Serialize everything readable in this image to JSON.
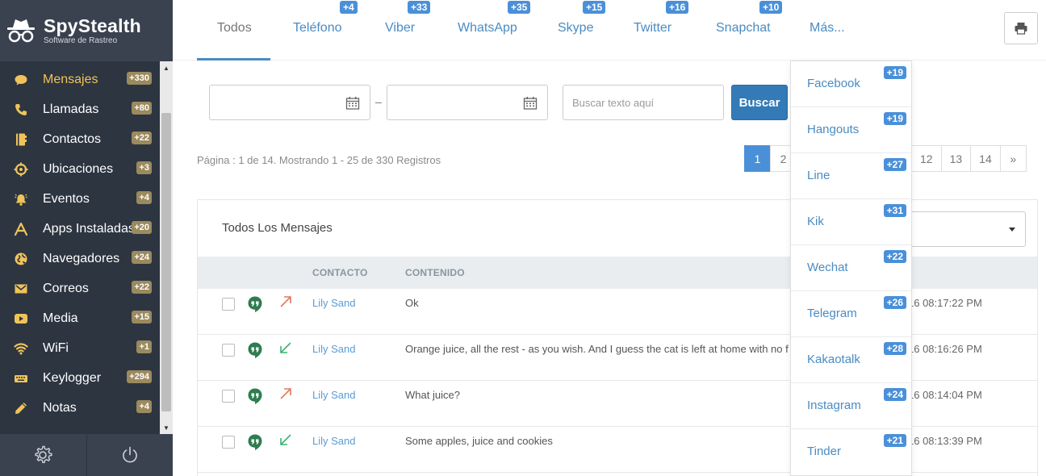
{
  "brand": {
    "name": "SpyStealth",
    "subtitle": "Software de Rastreo"
  },
  "sidebar": {
    "items": [
      {
        "label": "Mensajes",
        "badge": "+330",
        "icon": "chat-bubble-icon",
        "active": true
      },
      {
        "label": "Llamadas",
        "badge": "+80",
        "icon": "phone-icon"
      },
      {
        "label": "Contactos",
        "badge": "+22",
        "icon": "address-book-icon"
      },
      {
        "label": "Ubicaciones",
        "badge": "+3",
        "icon": "crosshair-icon"
      },
      {
        "label": "Eventos",
        "badge": "+4",
        "icon": "bell-icon"
      },
      {
        "label": "Apps Instaladas",
        "badge": "+20",
        "icon": "app-store-icon"
      },
      {
        "label": "Navegadores",
        "badge": "+24",
        "icon": "globe-icon"
      },
      {
        "label": "Correos",
        "badge": "+22",
        "icon": "envelope-icon"
      },
      {
        "label": "Media",
        "badge": "+15",
        "icon": "play-icon"
      },
      {
        "label": "WiFi",
        "badge": "+1",
        "icon": "wifi-icon"
      },
      {
        "label": "Keylogger",
        "badge": "+294",
        "icon": "keyboard-icon"
      },
      {
        "label": "Notas",
        "badge": "+4",
        "icon": "pencil-icon"
      }
    ]
  },
  "tabs": [
    {
      "label": "Todos",
      "badge": ""
    },
    {
      "label": "Teléfono",
      "badge": "+4"
    },
    {
      "label": "Viber",
      "badge": "+33"
    },
    {
      "label": "WhatsApp",
      "badge": "+35"
    },
    {
      "label": "Skype",
      "badge": "+15"
    },
    {
      "label": "Twitter",
      "badge": "+16"
    },
    {
      "label": "Snapchat",
      "badge": "+10"
    },
    {
      "label": "Más...",
      "badge": ""
    }
  ],
  "filters": {
    "search_placeholder": "Buscar texto aquí",
    "search_button": "Buscar",
    "date_separator": "–"
  },
  "pagination": {
    "info": "Página : 1 de 14. Mostrando 1 - 25 de 330 Registros",
    "pages": [
      "1",
      "2",
      "12",
      "13",
      "14",
      "»"
    ]
  },
  "panel": {
    "title": "Todos Los Mensajes",
    "columns": {
      "contact": "CONTACTO",
      "content": "CONTENIDO"
    },
    "rows": [
      {
        "direction": "outgoing",
        "contact": "Lily Sand",
        "content": "Ok",
        "time": "16 08:17:22 PM"
      },
      {
        "direction": "incoming",
        "contact": "Lily Sand",
        "content": "Orange juice, all the rest - as you wish. And I guess the cat is left at home with no f",
        "time": "16 08:16:26 PM"
      },
      {
        "direction": "outgoing",
        "contact": "Lily Sand",
        "content": "What juice?",
        "time": "16 08:14:04 PM"
      },
      {
        "direction": "incoming",
        "contact": "Lily Sand",
        "content": "Some apples, juice and cookies",
        "time": "16 08:13:39 PM"
      }
    ]
  },
  "more_menu": [
    {
      "label": "Facebook",
      "badge": "+19"
    },
    {
      "label": "Hangouts",
      "badge": "+19"
    },
    {
      "label": "Line",
      "badge": "+27"
    },
    {
      "label": "Kik",
      "badge": "+31"
    },
    {
      "label": "Wechat",
      "badge": "+22"
    },
    {
      "label": "Telegram",
      "badge": "+26"
    },
    {
      "label": "Kakaotalk",
      "badge": "+28"
    },
    {
      "label": "Instagram",
      "badge": "+24"
    },
    {
      "label": "Tinder",
      "badge": "+21"
    }
  ],
  "colors": {
    "sidebar_bg": "#2d3541",
    "active_menu": "#f0c35a",
    "accent_blue": "#4a90d9",
    "badge_gold": "#9b8a5e",
    "hangouts_green": "#2e7d4f",
    "outgoing_arrow": "#e07a5f",
    "incoming_arrow": "#3cb371"
  }
}
